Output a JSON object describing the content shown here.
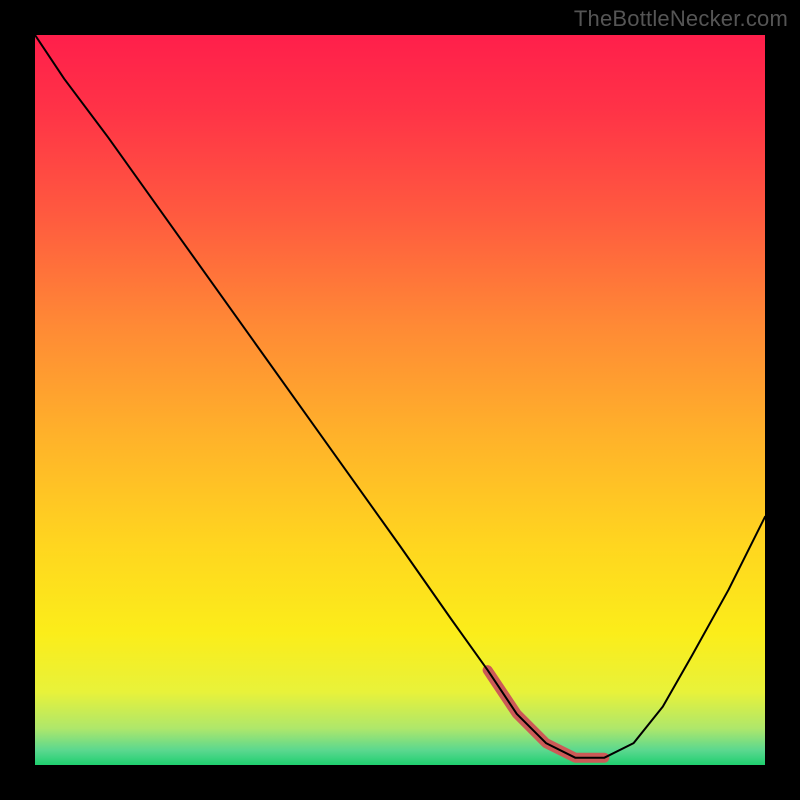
{
  "watermark": "TheBottleNecker.com",
  "chart_data": {
    "type": "line",
    "title": "",
    "xlabel": "",
    "ylabel": "",
    "xlim": [
      0,
      100
    ],
    "ylim": [
      0,
      100
    ],
    "x": [
      0,
      4,
      10,
      20,
      30,
      40,
      50,
      57,
      62,
      66,
      70,
      74,
      78,
      82,
      86,
      90,
      95,
      100
    ],
    "values": [
      100,
      94,
      86,
      72,
      58,
      44,
      30,
      20,
      13,
      7,
      3,
      1,
      1,
      3,
      8,
      15,
      24,
      34
    ],
    "highlight_range_x": [
      62,
      78
    ],
    "gradient_stops": [
      {
        "offset": 0.0,
        "color": "#ff1f4b"
      },
      {
        "offset": 0.1,
        "color": "#ff3247"
      },
      {
        "offset": 0.25,
        "color": "#ff5b3f"
      },
      {
        "offset": 0.4,
        "color": "#ff8a35"
      },
      {
        "offset": 0.55,
        "color": "#ffb22a"
      },
      {
        "offset": 0.7,
        "color": "#ffd61f"
      },
      {
        "offset": 0.82,
        "color": "#fbed1a"
      },
      {
        "offset": 0.9,
        "color": "#e8f23a"
      },
      {
        "offset": 0.95,
        "color": "#aee76b"
      },
      {
        "offset": 0.98,
        "color": "#5ad88f"
      },
      {
        "offset": 1.0,
        "color": "#1fcf6f"
      }
    ]
  },
  "colors": {
    "background": "#000000",
    "curve": "#000000",
    "highlight": "#cc5a57",
    "watermark": "#555555"
  }
}
